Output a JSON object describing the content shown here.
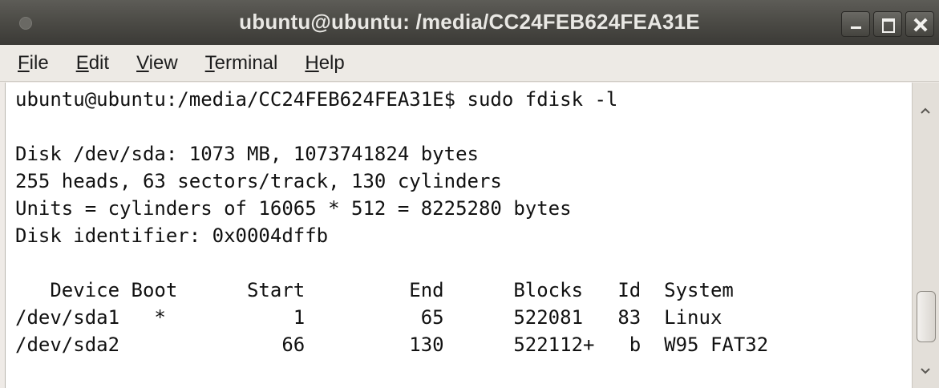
{
  "window": {
    "title": "ubuntu@ubuntu: /media/CC24FEB624FEA31E"
  },
  "menu": {
    "items": [
      {
        "label_mn": "F",
        "label_rest": "ile"
      },
      {
        "label_mn": "E",
        "label_rest": "dit"
      },
      {
        "label_mn": "V",
        "label_rest": "iew"
      },
      {
        "label_mn": "T",
        "label_rest": "erminal"
      },
      {
        "label_mn": "H",
        "label_rest": "elp"
      }
    ]
  },
  "terminal": {
    "lines": [
      "ubuntu@ubuntu:/media/CC24FEB624FEA31E$ sudo fdisk -l",
      "",
      "Disk /dev/sda: 1073 MB, 1073741824 bytes",
      "255 heads, 63 sectors/track, 130 cylinders",
      "Units = cylinders of 16065 * 512 = 8225280 bytes",
      "Disk identifier: 0x0004dffb",
      "",
      "   Device Boot      Start         End      Blocks   Id  System",
      "/dev/sda1   *           1          65      522081   83  Linux",
      "/dev/sda2              66         130      522112+   b  W95 FAT32"
    ]
  },
  "icons": {
    "close": "close-icon",
    "maximize": "maximize-icon",
    "minimize": "minimize-icon",
    "window_menu": "window-menu-icon",
    "scroll_up": "scroll-up-icon",
    "scroll_down": "scroll-down-icon"
  },
  "colors": {
    "titlebar": "#4d4c47",
    "title_text": "#e9e8e4",
    "menubar": "#edeae5",
    "terminal_bg": "#ffffff",
    "terminal_fg": "#111111"
  }
}
